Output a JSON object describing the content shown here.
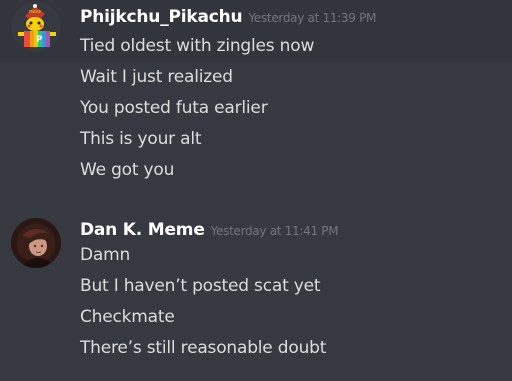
{
  "messages": [
    {
      "username": "Phijkchu_Pikachu",
      "timestamp": "Yesterday at 11:39 PM",
      "lines": [
        "Tied oldest with zingles now",
        "Wait I just realized",
        "You posted futa earlier",
        "This is your alt",
        "We got you"
      ]
    },
    {
      "username": "Dan K. Meme",
      "timestamp": "Yesterday at 11:41 PM",
      "lines": [
        "Damn",
        "But I haven’t posted scat yet",
        "Checkmate",
        "There’s still reasonable doubt"
      ]
    }
  ],
  "colors": {
    "background": "#36393f",
    "username": "#ffffff",
    "timestamp": "#72767d",
    "message_text": "#dcddde"
  },
  "icons": {
    "avatar_1": "pikachu-avatar-icon",
    "avatar_2": "dark-haired-character-avatar-icon"
  }
}
